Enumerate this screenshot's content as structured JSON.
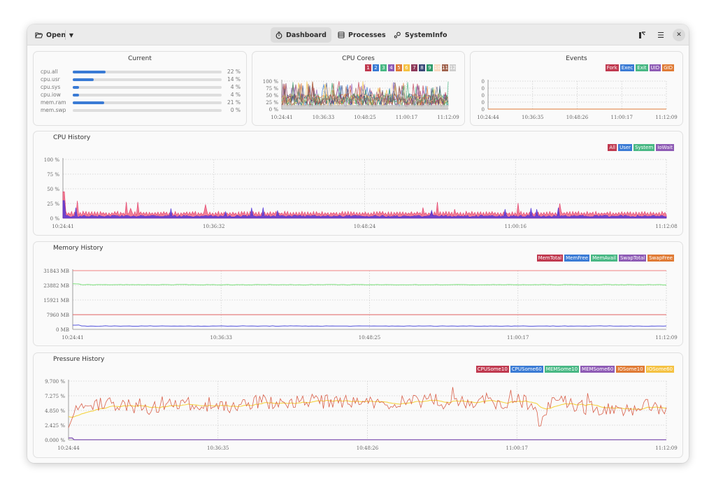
{
  "header": {
    "open_label": "Open",
    "tabs": [
      {
        "label": "Dashboard",
        "icon": "stopwatch-icon",
        "active": true
      },
      {
        "label": "Processes",
        "icon": "list-icon",
        "active": false
      },
      {
        "label": "SystemInfo",
        "icon": "gears-icon",
        "active": false
      }
    ]
  },
  "current": {
    "title": "Current",
    "rows": [
      {
        "label": "cpu.all",
        "value": 22,
        "text": "22 %"
      },
      {
        "label": "cpu.usr",
        "value": 14,
        "text": "14 %"
      },
      {
        "label": "cpu.sys",
        "value": 4,
        "text": "4 %"
      },
      {
        "label": "cpu.iow",
        "value": 4,
        "text": "4 %"
      },
      {
        "label": "mem.ram",
        "value": 21,
        "text": "21 %"
      },
      {
        "label": "mem.swp",
        "value": 0,
        "text": "0 %"
      }
    ]
  },
  "colors": {
    "red": "#c0394f",
    "blue": "#3a7bd5",
    "green": "#48b884",
    "purple": "#8e5bb5",
    "orange": "#e07b35",
    "yellow": "#f5c242",
    "maroon": "#8e3a5b",
    "navy": "#3b4a7a",
    "teal": "#2f9a6a",
    "peach": "#f8d9c0",
    "brown": "#a0634e",
    "grey": "#cfcfcf"
  },
  "chart_data": [
    {
      "id": "cpu_cores",
      "type": "line",
      "title": "CPU Cores",
      "legend": [
        "1",
        "2",
        "3",
        "4",
        "5",
        "6",
        "7",
        "8",
        "9",
        "10",
        "11",
        "12"
      ],
      "legend_colors": [
        "#c0394f",
        "#3a7bd5",
        "#48b884",
        "#8e5bb5",
        "#e07b35",
        "#f5c242",
        "#8e3a5b",
        "#3b4a7a",
        "#2f9a6a",
        "#f8d9c0",
        "#a0634e",
        "#cfcfcf"
      ],
      "yticks": [
        "100 %",
        "75 %",
        "50 %",
        "25 %",
        "0 %"
      ],
      "xticks": [
        "10:24:41",
        "10:36:33",
        "10:48:25",
        "11:00:17",
        "11:12:09"
      ],
      "ylim": [
        0,
        100
      ],
      "note": "12 noisy per-core series, typical 10-60 %, spikes to ~100 %"
    },
    {
      "id": "events",
      "type": "line",
      "title": "Events",
      "legend": [
        "Fork",
        "Exec",
        "Exit",
        "UID",
        "GID"
      ],
      "legend_colors": [
        "#c0394f",
        "#3a7bd5",
        "#48b884",
        "#8e5bb5",
        "#e07b35"
      ],
      "yticks": [
        "0",
        "0",
        "0",
        "0",
        "0"
      ],
      "xticks": [
        "10:24:44",
        "10:36:35",
        "10:48:26",
        "11:00:17",
        "11:12:09"
      ],
      "values": "all zero"
    },
    {
      "id": "cpu_history",
      "type": "area",
      "title": "CPU History",
      "legend": [
        "All",
        "User",
        "System",
        "IoWait"
      ],
      "legend_colors": [
        "#c0394f",
        "#3a7bd5",
        "#48b884",
        "#8e5bb5"
      ],
      "yticks": [
        "100 %",
        "75 %",
        "50 %",
        "25 %",
        "0 %"
      ],
      "xticks": [
        "10:24:41",
        "10:36:32",
        "10:48:24",
        "11:00:16",
        "11:12:08"
      ],
      "ylim": [
        0,
        100
      ],
      "series_summary": {
        "All": "≈5-10 %, initial spike ~45 %, spikes ~30 %",
        "User": "≈3-5 %"
      }
    },
    {
      "id": "memory_history",
      "type": "line",
      "title": "Memory History",
      "legend": [
        "MemTotal",
        "MemFree",
        "MemAvail",
        "SwapTotal",
        "SwapFree"
      ],
      "legend_colors": [
        "#c0394f",
        "#3a7bd5",
        "#48b884",
        "#8e5bb5",
        "#e07b35"
      ],
      "yticks": [
        "31843 MB",
        "23882 MB",
        "15921 MB",
        "7960 MB",
        "0 MB"
      ],
      "xticks": [
        "10:24:41",
        "10:36:33",
        "10:48:25",
        "11:00:17",
        "11:12:09"
      ],
      "ylim": [
        0,
        31843
      ],
      "series": [
        {
          "name": "MemTotal",
          "value": 31843
        },
        {
          "name": "MemAvail",
          "value": 24200
        },
        {
          "name": "SwapTotal",
          "value": 7960
        },
        {
          "name": "MemFree",
          "value": 1800
        }
      ]
    },
    {
      "id": "pressure_history",
      "type": "line",
      "title": "Pressure History",
      "legend": [
        "CPUSome10",
        "CPUSome60",
        "MEMSome10",
        "MEMSome60",
        "IOSome10",
        "IOSome60"
      ],
      "legend_colors": [
        "#c0394f",
        "#3a7bd5",
        "#48b884",
        "#8e5bb5",
        "#e07b35",
        "#f5c242"
      ],
      "yticks": [
        "9.700 %",
        "7.275 %",
        "4.850 %",
        "2.425 %",
        "0.000 %"
      ],
      "xticks": [
        "10:24:44",
        "10:36:35",
        "10:48:26",
        "11:00:17",
        "11:12:09"
      ],
      "ylim": [
        0,
        9.7
      ],
      "series_summary": {
        "CPUSome10": "≈4-8 %, noisy, peak ~9 %",
        "CPUSome60": "smoothed ≈5-6 %",
        "MEMSome60": "≈0 %"
      }
    }
  ]
}
